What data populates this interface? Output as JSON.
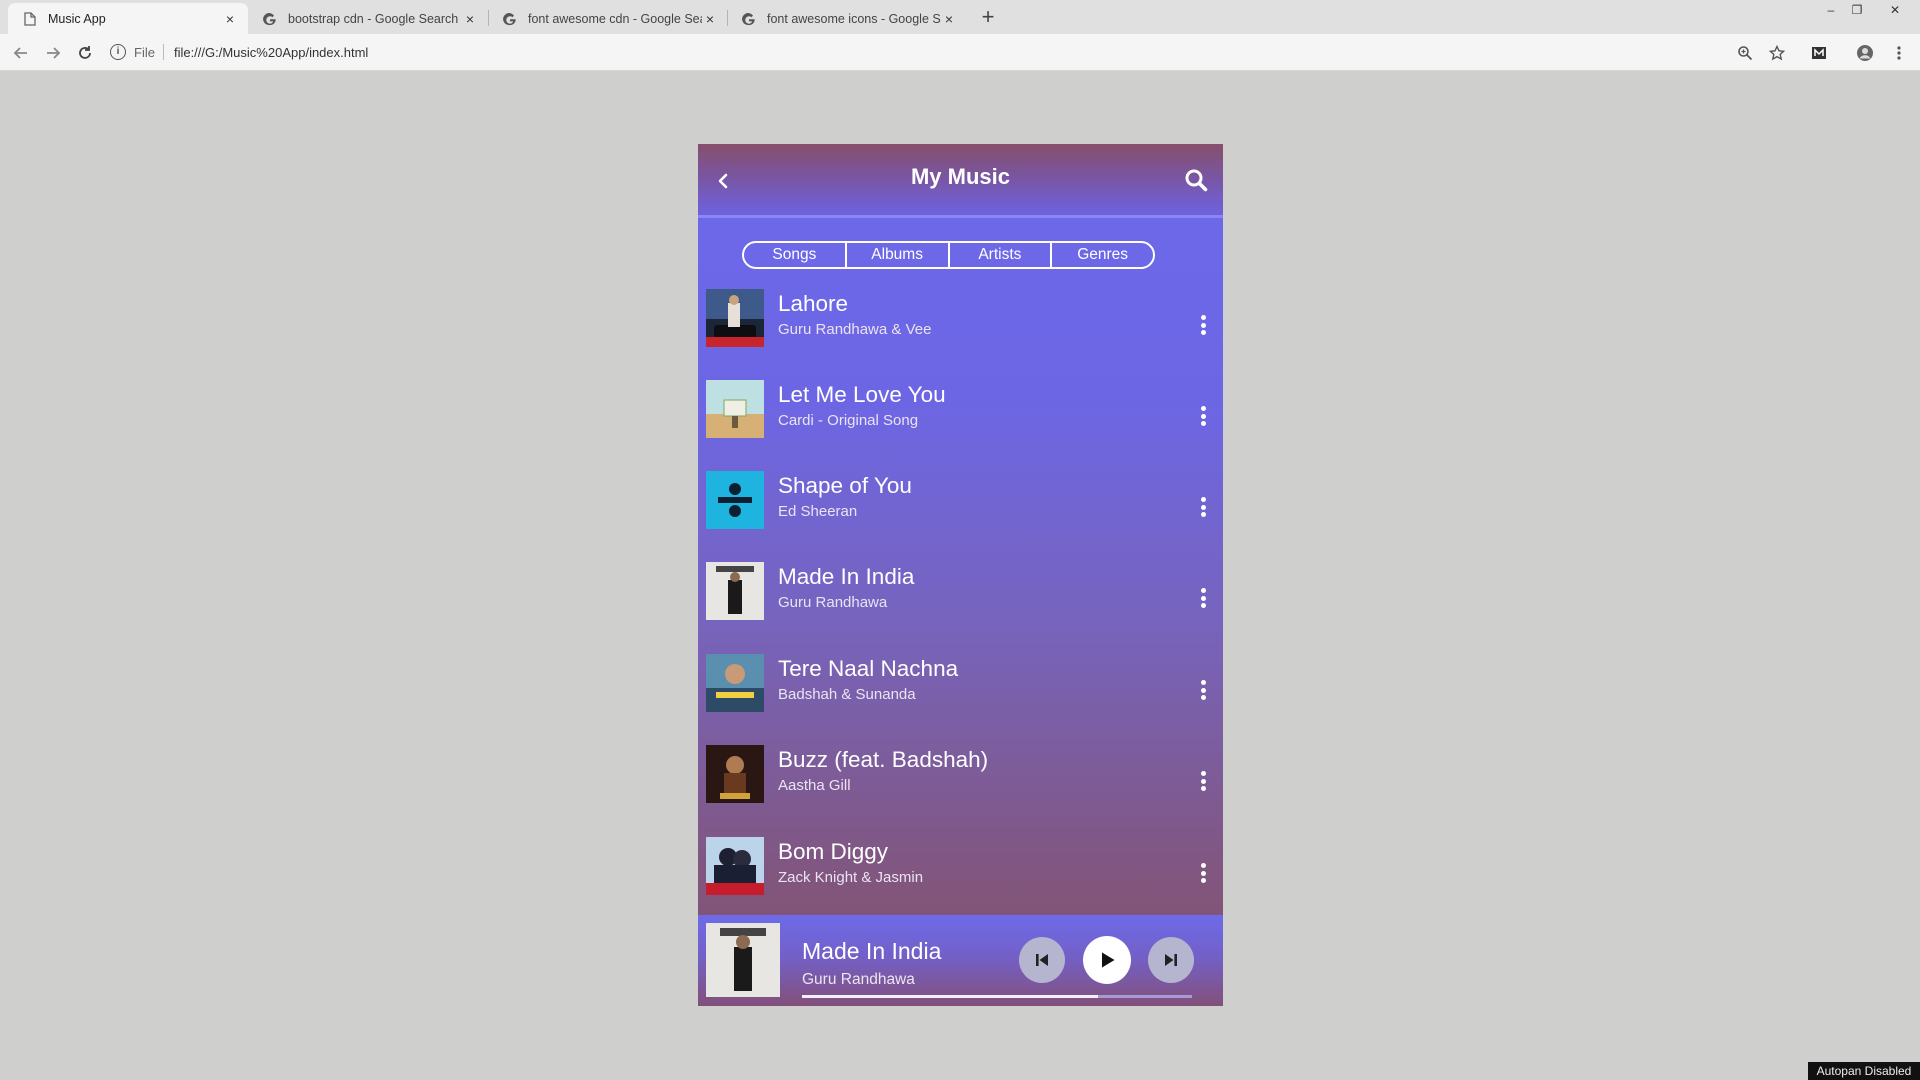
{
  "browser": {
    "tabs": [
      {
        "title": "Music App",
        "icon": "page-icon",
        "active": true
      },
      {
        "title": "bootstrap cdn - Google Search",
        "icon": "google-icon",
        "active": false
      },
      {
        "title": "font awesome cdn - Google Sear",
        "icon": "google-icon",
        "active": false
      },
      {
        "title": "font awesome icons - Google Se",
        "icon": "google-icon",
        "active": false
      }
    ],
    "close_glyph": "×",
    "new_tab_glyph": "+",
    "window_controls": {
      "minimize": "–",
      "restore": "❐",
      "close": "✕"
    },
    "address": {
      "scheme_label": "File",
      "url": "file:///G:/Music%20App/index.html",
      "info_glyph": "i"
    },
    "toolbar_icons": [
      "back-arrow-icon",
      "forward-arrow-icon",
      "reload-icon",
      "zoom-icon",
      "star-icon",
      "extension-icon",
      "profile-icon",
      "menu-dots-icon"
    ]
  },
  "app": {
    "title": "My Music",
    "tabs": [
      "Songs",
      "Albums",
      "Artists",
      "Genres"
    ],
    "songs": [
      {
        "title": "Lahore",
        "artist": "Guru Randhawa & Vee"
      },
      {
        "title": "Let Me Love You",
        "artist": "Cardi - Original Song"
      },
      {
        "title": "Shape of You",
        "artist": "Ed Sheeran"
      },
      {
        "title": "Made In India",
        "artist": "Guru Randhawa"
      },
      {
        "title": "Tere Naal Nachna",
        "artist": "Badshah & Sunanda"
      },
      {
        "title": "Buzz (feat. Badshah)",
        "artist": "Aastha Gill"
      },
      {
        "title": "Bom Diggy",
        "artist": "Zack Knight & Jasmin"
      }
    ],
    "now_playing": {
      "title": "Made In India",
      "artist": "Guru Randhawa",
      "progress": 0.76
    },
    "colors": {
      "accent": "#6d66e4",
      "header_top": "#86506b",
      "list_bottom": "#84506a"
    }
  },
  "footer_badge": "Autopan Disabled"
}
